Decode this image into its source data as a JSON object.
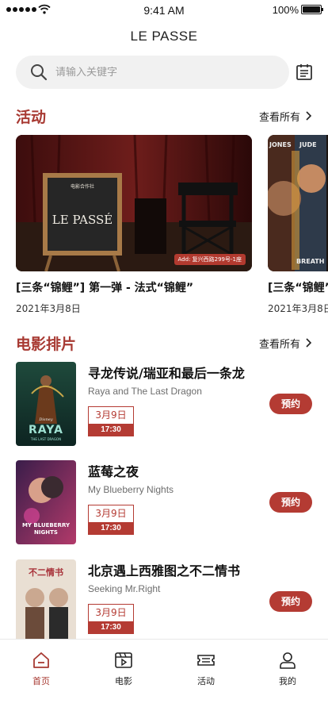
{
  "status_bar": {
    "time": "9:41 AM",
    "battery": "100%",
    "battery_level": 1.0
  },
  "header": {
    "title": "LE PASSE"
  },
  "search": {
    "placeholder": "请输入关键字"
  },
  "icons": {
    "search": "search-icon",
    "calendar": "calendar-icon",
    "chevron": "chevron-right-icon"
  },
  "colors": {
    "accent": "#a83a33",
    "button": "#b43b33",
    "search_bg": "#f1f1f1"
  },
  "events_section": {
    "title": "活动",
    "see_all": "查看所有",
    "cards": [
      {
        "title": "[三条“锦鲤”] 第一弹 - 法式“锦鲤”",
        "date": "2021年3月8日",
        "board_text": "LE PASSÉ",
        "board_sub": "电影合作社",
        "address": "Add: 复兴西路299号-1座"
      },
      {
        "title": "[三条“锦鲤”] 第二弹",
        "date": "2021年3月8日",
        "poster_text_1": "JONES",
        "poster_text_2": "JUDE",
        "poster_text_3": "BREATH"
      }
    ]
  },
  "movies_section": {
    "title": "电影排片",
    "see_all": "查看所有",
    "items": [
      {
        "title": "寻龙传说/瑞亚和最后一条龙",
        "subtitle": "Raya and The Last Dragon",
        "date": "3月9日",
        "time": "17:30",
        "book": "预约",
        "poster_title": "RAYA",
        "poster_sub": "THE LAST DRAGON",
        "poster_brand": "Disney"
      },
      {
        "title": "蓝莓之夜",
        "subtitle": "My Blueberry Nights",
        "date": "3月9日",
        "time": "17:30",
        "book": "预约",
        "poster_title": "MY BLUEBERRY NIGHTS"
      },
      {
        "title": "北京遇上西雅图之不二情书",
        "subtitle": "Seeking Mr.Right",
        "date": "3月9日",
        "time": "17:30",
        "book": "预约",
        "poster_title": "不二情书"
      }
    ]
  },
  "tabs": [
    {
      "label": "首页",
      "icon": "home-icon",
      "active": true
    },
    {
      "label": "电影",
      "icon": "film-icon",
      "active": false
    },
    {
      "label": "活动",
      "icon": "ticket-icon",
      "active": false
    },
    {
      "label": "我的",
      "icon": "user-icon",
      "active": false
    }
  ]
}
